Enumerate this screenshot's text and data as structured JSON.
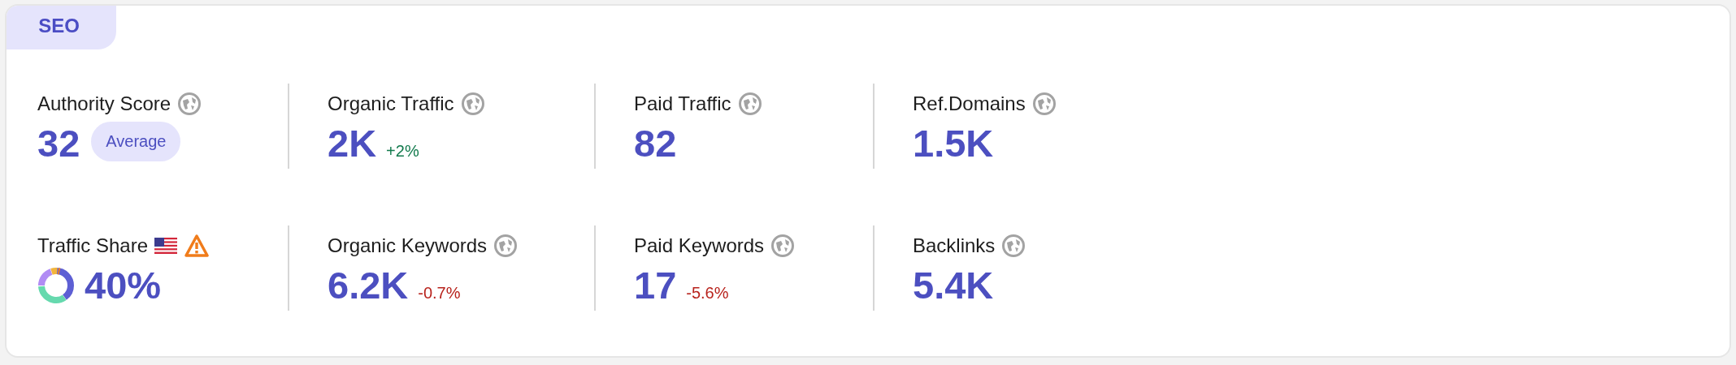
{
  "tab": {
    "label": "SEO",
    "selected": true
  },
  "metrics": [
    {
      "label": "Authority Score",
      "icons": [
        {
          "kind": "globe"
        }
      ],
      "value": "32",
      "badge": "Average"
    },
    {
      "label": "Organic Traffic",
      "icons": [
        {
          "kind": "globe"
        }
      ],
      "value": "2K",
      "change": {
        "text": "+2%",
        "color": "#127a4d"
      }
    },
    {
      "label": "Paid Traffic",
      "icons": [
        {
          "kind": "globe"
        }
      ],
      "value": "82"
    },
    {
      "label": "Ref.Domains",
      "icons": [
        {
          "kind": "globe"
        }
      ],
      "value": "1.5K"
    },
    {
      "label": "Traffic Share",
      "icons": [
        {
          "kind": "flag"
        },
        {
          "kind": "warning"
        }
      ],
      "value": "40%",
      "donut": true
    },
    {
      "label": "Organic Keywords",
      "icons": [
        {
          "kind": "globe"
        }
      ],
      "value": "6.2K",
      "change": {
        "text": "-0.7%",
        "color": "#b8231d"
      }
    },
    {
      "label": "Paid Keywords",
      "icons": [
        {
          "kind": "globe"
        }
      ],
      "value": "17",
      "change": {
        "text": "-5.6%",
        "color": "#b8231d"
      }
    },
    {
      "label": "Backlinks",
      "icons": [
        {
          "kind": "globe"
        }
      ],
      "value": "5.4K"
    }
  ]
}
